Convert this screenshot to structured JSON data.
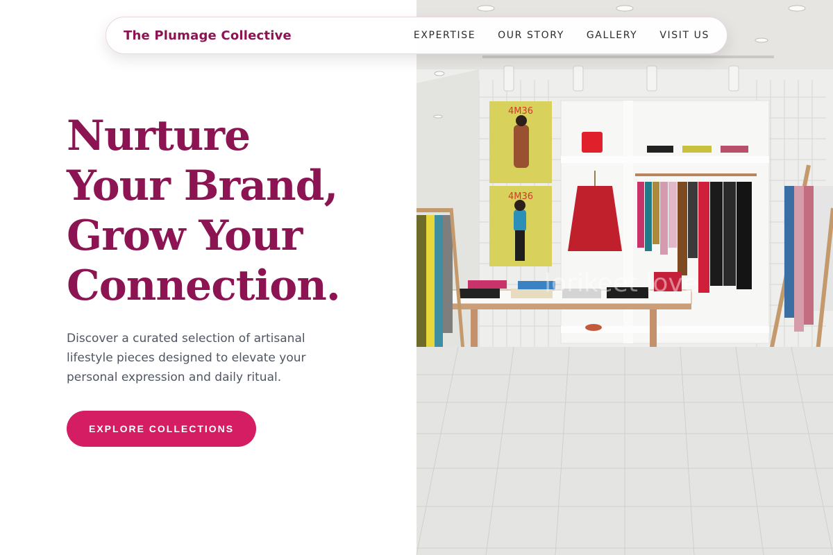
{
  "brand": {
    "name": "The Plumage Collective",
    "color": "#8c1452"
  },
  "nav": {
    "links": [
      "EXPERTISE",
      "OUR STORY",
      "GALLERY",
      "VISIT US"
    ]
  },
  "hero": {
    "headline_lines": [
      "Nurture",
      "Your Brand,",
      "Grow Your",
      "Connection."
    ],
    "subtext": "Discover a curated selection of artisanal lifestyle pieces designed to elevate your personal expression and daily ritual.",
    "cta_label": "EXPLORE COLLECTIONS",
    "image_alt": "Boutique clothing store interior with garment racks, shelves and a display table",
    "poster_text": [
      "4M36",
      "4M36"
    ],
    "watermark": "lorikeet love"
  },
  "colors": {
    "accent": "#d41d62",
    "headline": "#8c1452",
    "body_text": "#4f5661"
  }
}
